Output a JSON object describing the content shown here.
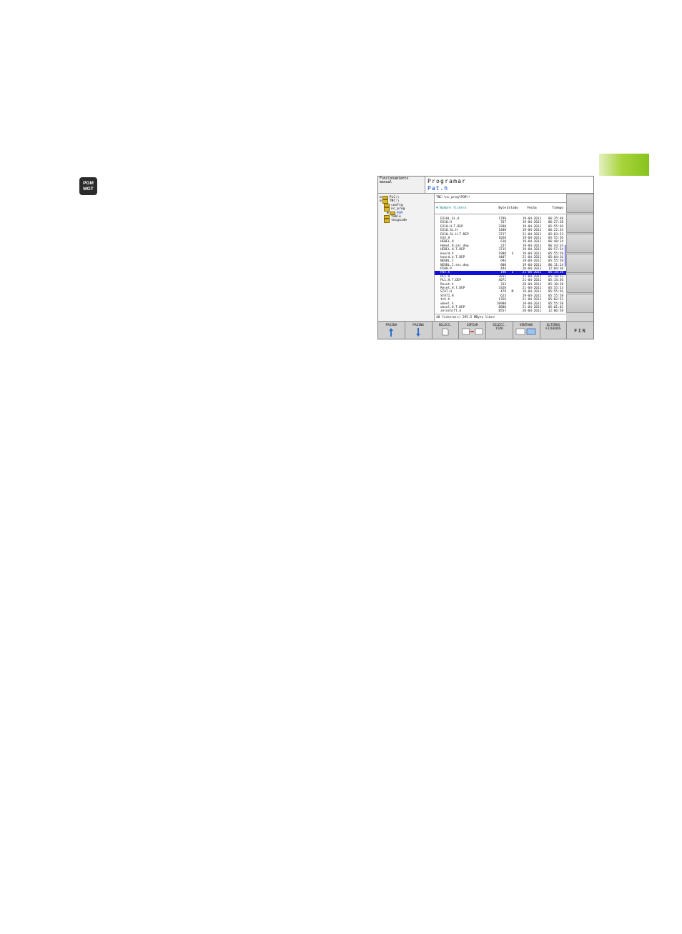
{
  "pgm_key": {
    "line1": "PGM",
    "line2": "MGT"
  },
  "mode": {
    "line1": "Funcionamiento",
    "line2": "manual"
  },
  "program": {
    "title": "Programar",
    "file": "Pat.h"
  },
  "tree": [
    {
      "prefix": "⊟",
      "label": "PLC:\\",
      "indent": 0,
      "selected": false
    },
    {
      "prefix": "⊟",
      "label": "TNC:\\",
      "indent": 0,
      "selected": false
    },
    {
      "prefix": "",
      "label": "config",
      "indent": 1,
      "selected": false
    },
    {
      "prefix": "",
      "label": "nc_prog",
      "indent": 1,
      "selected": false
    },
    {
      "prefix": "⊞",
      "label": "PGM",
      "indent": 2,
      "selected": true
    },
    {
      "prefix": "",
      "label": "table",
      "indent": 1,
      "selected": false
    },
    {
      "prefix": "",
      "label": "tncguide",
      "indent": 1,
      "selected": false
    }
  ],
  "path": "TNC:\\nc_prog\\PGM\\*",
  "columns": {
    "name": "▼ Nombre fichero",
    "bytes": "Byte",
    "state": "Estado",
    "date": "Fecha",
    "time": "Tiempo"
  },
  "files": [
    {
      "name": "EX10L.SL.H",
      "bytes": "1789",
      "state": "",
      "date": "19-04-2011",
      "time": "06:35:48",
      "selected": false
    },
    {
      "name": "EX10.H",
      "bytes": "767",
      "state": "",
      "date": "19-04-2011",
      "time": "06:27:28",
      "selected": false
    },
    {
      "name": "EX10.H.T.DEP",
      "bytes": "3280",
      "state": "",
      "date": "19-04-2011",
      "time": "05:55:56",
      "selected": false
    },
    {
      "name": "EX10.SL.H",
      "bytes": "1408",
      "state": "",
      "date": "19-04-2011",
      "time": "06:22:34",
      "selected": false
    },
    {
      "name": "EX10.SL.H.T.DEP",
      "bytes": "3717",
      "state": "",
      "date": "21-04-2011",
      "time": "05:03:53",
      "selected": false
    },
    {
      "name": "EX4.H",
      "bytes": "1058",
      "state": "",
      "date": "19-04-2011",
      "time": "05:55:56",
      "selected": false
    },
    {
      "name": "HEBEL.H",
      "bytes": "610",
      "state": "",
      "date": "19-04-2011",
      "time": "06:48:34",
      "selected": false
    },
    {
      "name": "Hebel.H.sec.dep",
      "bytes": "237",
      "state": "",
      "date": "19-04-2011",
      "time": "06:43:34",
      "selected": false
    },
    {
      "name": "HEBEL.H.T.DEP",
      "bytes": "3715",
      "state": "",
      "date": "19-04-2011",
      "time": "06:57:54",
      "selected": false
    },
    {
      "name": "koord.h",
      "bytes": "1988",
      "state": "S",
      "date": "19-04-2011",
      "time": "05:55:58",
      "selected": false
    },
    {
      "name": "koord.h.T.DEP",
      "bytes": "4407",
      "state": "",
      "date": "21-04-2011",
      "time": "05:04:16",
      "selected": false
    },
    {
      "name": "NEUBL.I",
      "bytes": "694",
      "state": "",
      "date": "19-04-2011",
      "time": "05:55:58",
      "selected": false
    },
    {
      "name": "NEUBL.I.sec.dep",
      "bytes": "808",
      "state": "",
      "date": "19-04-2011",
      "time": "06:11:24",
      "selected": false
    },
    {
      "name": "PI00.P",
      "bytes": "444",
      "state": "",
      "date": "20-04-2011",
      "time": "12:04:30",
      "selected": false
    },
    {
      "name": "Pat.h",
      "bytes": "196",
      "state": "E",
      "date": "21-04-2011",
      "time": "05:14:38",
      "selected": true
    },
    {
      "name": "PL1.H",
      "bytes": "2811",
      "state": "",
      "date": "21-04-2011",
      "time": "05:10:53",
      "selected": false
    },
    {
      "name": "PL1.H.T.DEP",
      "bytes": "4071",
      "state": "",
      "date": "21-04-2011",
      "time": "05:14:36",
      "selected": false
    },
    {
      "name": "Reset.h",
      "bytes": "332",
      "state": "",
      "date": "20-04-2011",
      "time": "05:10:28",
      "selected": false
    },
    {
      "name": "Reset.H.T.DEP",
      "bytes": "3328",
      "state": "",
      "date": "21-04-2011",
      "time": "05:55:53",
      "selected": false
    },
    {
      "name": "STAT.H",
      "bytes": "479",
      "state": "M",
      "date": "19-04-2011",
      "time": "05:55:56",
      "selected": false
    },
    {
      "name": "STAT1.H",
      "bytes": "623",
      "state": "",
      "date": "19-04-2011",
      "time": "05:55:58",
      "selected": false
    },
    {
      "name": "tch.h",
      "bytes": "1356",
      "state": "",
      "date": "21-04-2011",
      "time": "05:02:53",
      "selected": false
    },
    {
      "name": "wheel.h",
      "bytes": "10988",
      "state": "",
      "date": "19-04-2011",
      "time": "05:55:58",
      "selected": false
    },
    {
      "name": "wheel.H.T.DEP",
      "bytes": "8888",
      "state": "",
      "date": "21-04-2011",
      "time": "05:01:02",
      "selected": false
    },
    {
      "name": "zeroshift.d",
      "bytes": "8557",
      "state": "",
      "date": "20-04-2011",
      "time": "12:06:58",
      "selected": false
    }
  ],
  "status": "48  fichero(s)   295.5 MByte libre",
  "softkeys": [
    {
      "line1": "PAGINA",
      "line2": "",
      "icon": "arrow-up-icon"
    },
    {
      "line1": "PAGINA",
      "line2": "",
      "icon": "arrow-down-icon"
    },
    {
      "line1": "SELECC.",
      "line2": "",
      "icon": "select-file-icon"
    },
    {
      "line1": "COPIAR",
      "line2": "",
      "icon": "copy-abc-xyz-icon"
    },
    {
      "line1": "SELECC.",
      "line2": "TIPO",
      "icon": "select-type-icon"
    },
    {
      "line1": "VENTANA",
      "line2": "",
      "icon": "window-layout-icon"
    },
    {
      "line1": "ULTIMOS",
      "line2": "FICHEROS",
      "icon": "recent-files-icon"
    },
    {
      "line1": "FIN",
      "line2": "",
      "icon": ""
    }
  ],
  "colors": {
    "accent_green": "#86c21c",
    "selection_blue": "#1010d8",
    "filename_blue": "#0044c8"
  }
}
